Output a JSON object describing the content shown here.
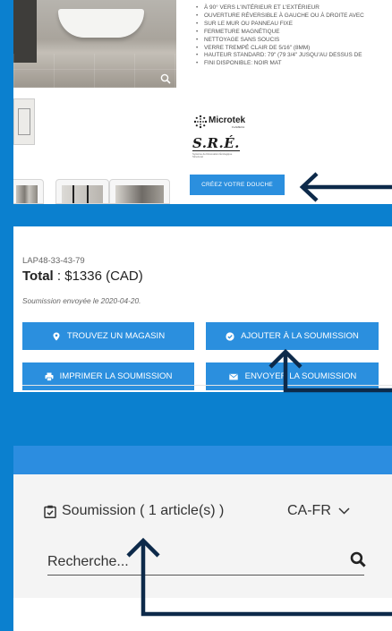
{
  "panel1": {
    "features": [
      "À 90° vers l'intérieur et l'extérieur",
      "Ouverture réversible à gauche ou à droite avec",
      "sur le mur ou panneau fixe",
      "Fermeture magnétique",
      "Nettoyage sans soucis",
      "Verre trempé clair de 5/16\" (8mm)",
      "Hauteur standard: 79\" (79 3/4\" jusqu'au dessus de",
      "Fini disponible: noir mat"
    ],
    "logo_microtek": "Microtek",
    "logo_microtek_sub": "FLAMECH",
    "logo_sre": "S.R.É.",
    "logo_sre_fine": "Système de Rénovation Écologique Structurel",
    "create_button": "Créez votre douche"
  },
  "panel2": {
    "sku": "LAP48-33-43-79",
    "total_label": "Total",
    "total_value": " : $1336 (CAD)",
    "sent_text": "Soumission envoyée le 2020-04-20.",
    "buttons": {
      "find_store": "Trouvez un magasin",
      "add_quote": "Ajouter à la soumission",
      "print_quote": "Imprimer la soumission",
      "send_quote": "Envoyer la soumission"
    }
  },
  "panel3": {
    "quote_link": "Soumission ( 1 article(s) )",
    "language": "CA-FR",
    "search_placeholder": "Recherche..."
  },
  "colors": {
    "background": "#0b80cf",
    "button_blue": "#2b8fde",
    "arrow": "#0d2a4a"
  }
}
